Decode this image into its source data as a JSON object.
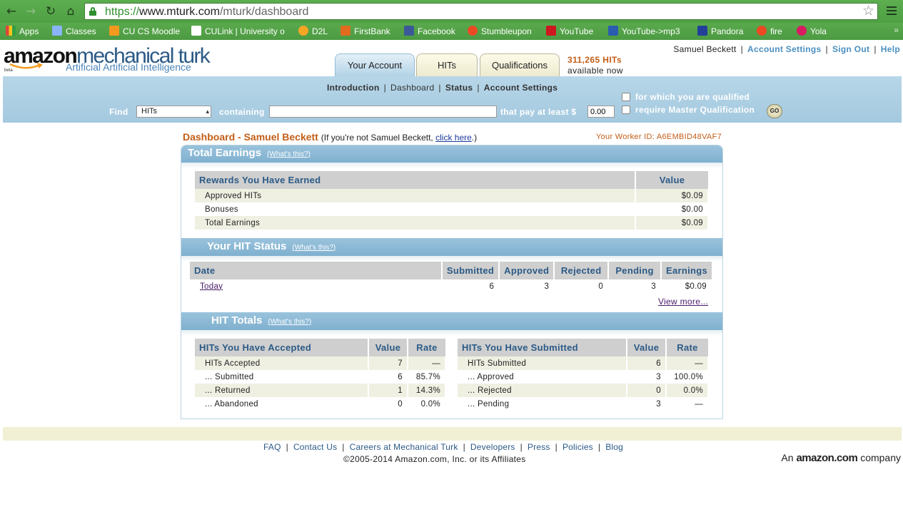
{
  "browser": {
    "url_scheme": "https://",
    "url_host": "www.mturk.com",
    "url_path": "/mturk/dashboard",
    "bookmarks": [
      {
        "label": "Apps",
        "color": "#e0443c"
      },
      {
        "label": "Classes",
        "color": "#8ab4f8"
      },
      {
        "label": "CU CS Moodle",
        "color": "#f39a1e"
      },
      {
        "label": "CULink | University o",
        "color": "#ffffff"
      },
      {
        "label": "D2L",
        "color": "#f5a623"
      },
      {
        "label": "FirstBank",
        "color": "#e36b1d"
      },
      {
        "label": "Facebook",
        "color": "#3b5998"
      },
      {
        "label": "Stumbleupon",
        "color": "#eb4924"
      },
      {
        "label": "YouTube",
        "color": "#cc181e"
      },
      {
        "label": "YouTube->mp3",
        "color": "#2a5db0"
      },
      {
        "label": "Pandora",
        "color": "#224099"
      },
      {
        "label": "fire",
        "color": "#eb4924"
      },
      {
        "label": "Yola",
        "color": "#d81b60"
      }
    ],
    "more": "»"
  },
  "header": {
    "logo_amazon": "amazon",
    "logo_mturk": "mechanical turk",
    "logo_beta": "beta",
    "logo_tagline": "Artificial Artificial Intelligence",
    "tabs": [
      "Your Account",
      "HITs",
      "Qualifications"
    ],
    "hits_count": "311,265 HITs",
    "hits_available": "available now",
    "user": "Samuel Beckett",
    "account_settings": "Account Settings",
    "sign_out": "Sign Out",
    "help": "Help"
  },
  "subnav": {
    "introduction": "Introduction",
    "dashboard": "Dashboard",
    "status": "Status",
    "account_settings": "Account Settings"
  },
  "search": {
    "find_label": "Find",
    "find_value": "HITs",
    "containing_label": "containing",
    "containing_value": "",
    "pay_label": "that pay at least $",
    "pay_value": "0.00",
    "qualified_label": "for which you are qualified",
    "master_label": "require Master Qualification",
    "go": "GO"
  },
  "dashboard": {
    "title": "Dashboard - Samuel Beckett",
    "note_prefix": "(If you're not Samuel Beckett,",
    "note_link": "click here",
    "note_suffix": ".)",
    "worker_id": "Your Worker ID: A6EMBID48VAF7",
    "whats_this": "(What's this?)",
    "earnings": {
      "heading": "Total Earnings",
      "col_reward": "Rewards You Have Earned",
      "col_value": "Value",
      "rows": [
        {
          "label": "Approved HITs",
          "value": "$0.09"
        },
        {
          "label": "Bonuses",
          "value": "$0.00"
        },
        {
          "label": "Total Earnings",
          "value": "$0.09"
        }
      ]
    },
    "hit_status": {
      "heading": "Your HIT Status",
      "columns": [
        "Date",
        "Submitted",
        "Approved",
        "Rejected",
        "Pending",
        "Earnings"
      ],
      "rows": [
        {
          "date": "Today",
          "submitted": "6",
          "approved": "3",
          "rejected": "0",
          "pending": "3",
          "earnings": "$0.09"
        }
      ],
      "view_more": "View more..."
    },
    "hit_totals": {
      "heading": "HIT Totals",
      "accepted": {
        "columns": [
          "HITs You Have Accepted",
          "Value",
          "Rate"
        ],
        "rows": [
          {
            "label": "HITs Accepted",
            "value": "7",
            "rate": "—"
          },
          {
            "label": "... Submitted",
            "value": "6",
            "rate": "85.7%"
          },
          {
            "label": "... Returned",
            "value": "1",
            "rate": "14.3%"
          },
          {
            "label": "... Abandoned",
            "value": "0",
            "rate": "0.0%"
          }
        ]
      },
      "submitted": {
        "columns": [
          "HITs You Have Submitted",
          "Value",
          "Rate"
        ],
        "rows": [
          {
            "label": "HITs Submitted",
            "value": "6",
            "rate": "—"
          },
          {
            "label": "... Approved",
            "value": "3",
            "rate": "100.0%"
          },
          {
            "label": "... Rejected",
            "value": "0",
            "rate": "0.0%"
          },
          {
            "label": "... Pending",
            "value": "3",
            "rate": "—"
          }
        ]
      }
    }
  },
  "footer": {
    "links": [
      "FAQ",
      "Contact Us",
      "Careers at Mechanical Turk",
      "Developers",
      "Press",
      "Policies",
      "Blog"
    ],
    "copyright": "©2005-2014 Amazon.com, Inc. or its Affiliates",
    "company_prefix": "An",
    "company_brand": "amazon.com",
    "company_suffix": "company"
  }
}
